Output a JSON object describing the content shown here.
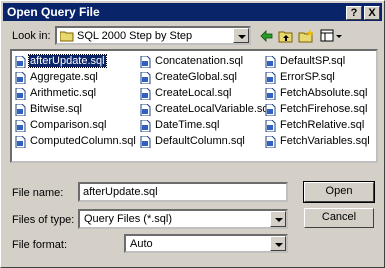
{
  "window": {
    "title": "Open Query File",
    "help_label": "?",
    "close_label": "X"
  },
  "lookin": {
    "label": "Look in:",
    "value": "SQL 2000 Step by Step"
  },
  "files": {
    "col1": [
      "afterUpdate.sql",
      "Aggregate.sql",
      "Arithmetic.sql",
      "Bitwise.sql",
      "Comparison.sql",
      "ComputedColumn.sql"
    ],
    "col2": [
      "Concatenation.sql",
      "CreateGlobal.sql",
      "CreateLocal.sql",
      "CreateLocalVariable.sql",
      "DateTime.sql",
      "DefaultColumn.sql"
    ],
    "col3": [
      "DefaultSP.sql",
      "ErrorSP.sql",
      "FetchAbsolute.sql",
      "FetchFirehose.sql",
      "FetchRelative.sql",
      "FetchVariables.sql"
    ]
  },
  "filename": {
    "label": "File name:",
    "value": "afterUpdate.sql"
  },
  "filetype": {
    "label": "Files of type:",
    "value": "Query Files (*.sql)"
  },
  "fileformat": {
    "label": "File format:",
    "value": "Auto"
  },
  "buttons": {
    "open": "Open",
    "cancel": "Cancel"
  }
}
